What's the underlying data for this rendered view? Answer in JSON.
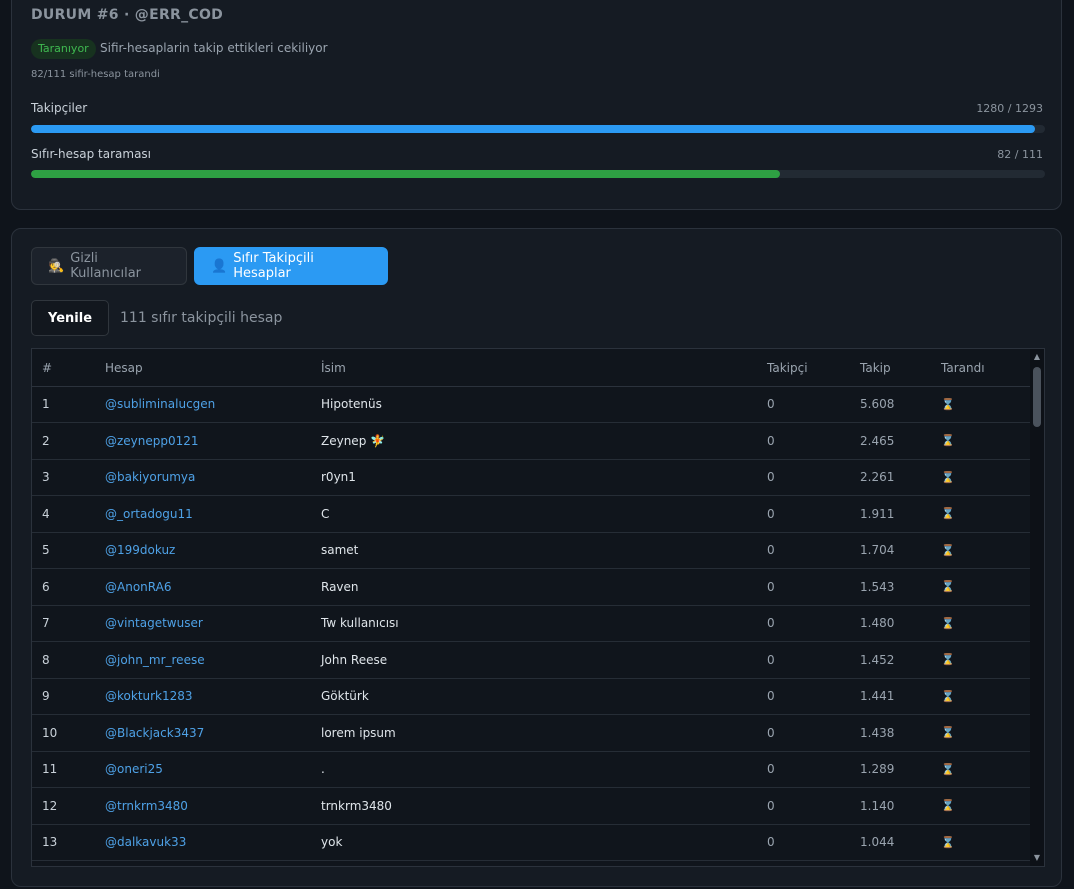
{
  "status": {
    "title": "DURUM #6 · @ERR_COD",
    "badge": "Taranıyor",
    "message": "Sifir-hesaplarin takip ettikleri cekiliyor",
    "scan_sub": "82/111 sifir-hesap tarandi",
    "progress": [
      {
        "label": "Takipçiler",
        "count": "1280 / 1293",
        "fraction": 0.99,
        "color": "#2b9af3"
      },
      {
        "label": "Sıfır-hesap taraması",
        "count": "82 / 111",
        "fraction": 0.739,
        "color": "#2ea043"
      }
    ]
  },
  "tabs": {
    "hidden_label": "Gizli Kullanıcılar",
    "hidden_icon": "detective-icon",
    "zero_label": "Sıfır Takipçili Hesaplar",
    "zero_icon": "person-icon"
  },
  "toolbar": {
    "refresh_label": "Yenile",
    "count_text": "111 sıfır takipçili hesap"
  },
  "table": {
    "headers": {
      "num": "#",
      "account": "Hesap",
      "name": "İsim",
      "followers": "Takipçi",
      "following": "Takip",
      "scanned": "Tarandı"
    },
    "scanned_icon": "hourglass-icon",
    "rows": [
      {
        "num": "1",
        "account": "@subliminalucgen",
        "name": "Hipotenüs",
        "followers": "0",
        "following": "5.608",
        "scanned": "⌛"
      },
      {
        "num": "2",
        "account": "@zeynepp0121",
        "name": "Zeynep 🧚",
        "followers": "0",
        "following": "2.465",
        "scanned": "⌛"
      },
      {
        "num": "3",
        "account": "@bakiyorumya",
        "name": "r0yn1",
        "followers": "0",
        "following": "2.261",
        "scanned": "⌛"
      },
      {
        "num": "4",
        "account": "@_ortadogu11",
        "name": "C",
        "followers": "0",
        "following": "1.911",
        "scanned": "⌛"
      },
      {
        "num": "5",
        "account": "@199dokuz",
        "name": "samet",
        "followers": "0",
        "following": "1.704",
        "scanned": "⌛"
      },
      {
        "num": "6",
        "account": "@AnonRA6",
        "name": "Raven",
        "followers": "0",
        "following": "1.543",
        "scanned": "⌛"
      },
      {
        "num": "7",
        "account": "@vintagetwuser",
        "name": "Tw kullanıcısı",
        "followers": "0",
        "following": "1.480",
        "scanned": "⌛"
      },
      {
        "num": "8",
        "account": "@john_mr_reese",
        "name": "John Reese",
        "followers": "0",
        "following": "1.452",
        "scanned": "⌛"
      },
      {
        "num": "9",
        "account": "@kokturk1283",
        "name": "Göktürk",
        "followers": "0",
        "following": "1.441",
        "scanned": "⌛"
      },
      {
        "num": "10",
        "account": "@Blackjack3437",
        "name": "lorem ipsum",
        "followers": "0",
        "following": "1.438",
        "scanned": "⌛"
      },
      {
        "num": "11",
        "account": "@oneri25",
        "name": ".",
        "followers": "0",
        "following": "1.289",
        "scanned": "⌛"
      },
      {
        "num": "12",
        "account": "@trnkrm3480",
        "name": "trnkrm3480",
        "followers": "0",
        "following": "1.140",
        "scanned": "⌛"
      },
      {
        "num": "13",
        "account": "@dalkavuk33",
        "name": "yok",
        "followers": "0",
        "following": "1.044",
        "scanned": "⌛"
      }
    ]
  }
}
